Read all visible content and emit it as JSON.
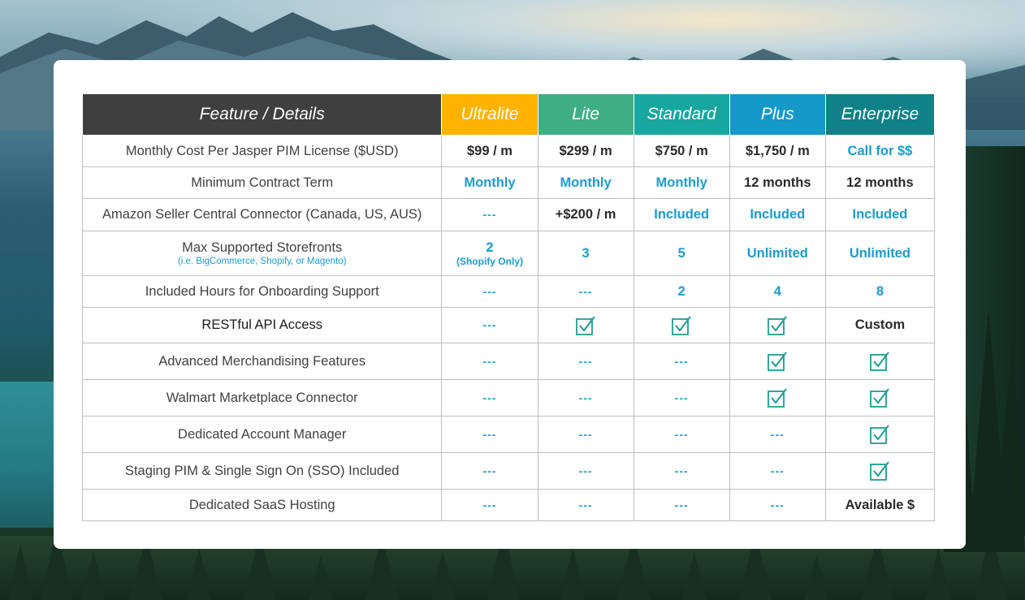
{
  "table": {
    "headers": {
      "feature": "Feature / Details",
      "ultralite": "Ultralite",
      "lite": "Lite",
      "standard": "Standard",
      "plus": "Plus",
      "enterprise": "Enterprise"
    },
    "header_colors": {
      "feature": "#3f3f3f",
      "ultralite": "#ffb300",
      "lite": "#3fae85",
      "standard": "#18a6a0",
      "plus": "#1499c9",
      "enterprise": "#0f8187"
    },
    "accent_blue": "#1b9bd1",
    "rows": [
      {
        "feature": "Monthly Cost Per Jasper PIM License ($USD)",
        "ultralite": "$99 / m",
        "lite": "$299 / m",
        "standard": "$750 / m",
        "plus": "$1,750 / m",
        "enterprise": "Call for $$"
      },
      {
        "feature": "Minimum Contract Term",
        "ultralite": "Monthly",
        "lite": "Monthly",
        "standard": "Monthly",
        "plus": "12 months",
        "enterprise": "12 months"
      },
      {
        "feature": "Amazon Seller Central Connector (Canada, US, AUS)",
        "ultralite": "---",
        "lite": "+$200 / m",
        "standard": "Included",
        "plus": "Included",
        "enterprise": "Included"
      },
      {
        "feature": "Max Supported Storefronts",
        "feature_sub": "(i.e. BigCommerce, Shopify, or Magento)",
        "ultralite": "2",
        "ultralite_sub": "(Shopify Only)",
        "lite": "3",
        "standard": "5",
        "plus": "Unlimited",
        "enterprise": "Unlimited"
      },
      {
        "feature": "Included Hours for Onboarding Support",
        "ultralite": "---",
        "lite": "---",
        "standard": "2",
        "plus": "4",
        "enterprise": "8"
      },
      {
        "feature": "RESTful API Access",
        "ultralite": "---",
        "lite": "check",
        "standard": "check",
        "plus": "check",
        "enterprise": "Custom"
      },
      {
        "feature": "Advanced Merchandising Features",
        "ultralite": "---",
        "lite": "---",
        "standard": "---",
        "plus": "check",
        "enterprise": "check"
      },
      {
        "feature": "Walmart Marketplace Connector",
        "ultralite": "---",
        "lite": "---",
        "standard": "---",
        "plus": "check",
        "enterprise": "check"
      },
      {
        "feature": "Dedicated Account Manager",
        "ultralite": "---",
        "lite": "---",
        "standard": "---",
        "plus": "---",
        "enterprise": "check"
      },
      {
        "feature": "Staging PIM & Single Sign On (SSO) Included",
        "ultralite": "---",
        "lite": "---",
        "standard": "---",
        "plus": "---",
        "enterprise": "check"
      },
      {
        "feature": "Dedicated SaaS Hosting",
        "ultralite": "---",
        "lite": "---",
        "standard": "---",
        "plus": "---",
        "enterprise": "Available $"
      }
    ],
    "icons": {
      "included_mark": "checkbox-checked-icon"
    }
  }
}
